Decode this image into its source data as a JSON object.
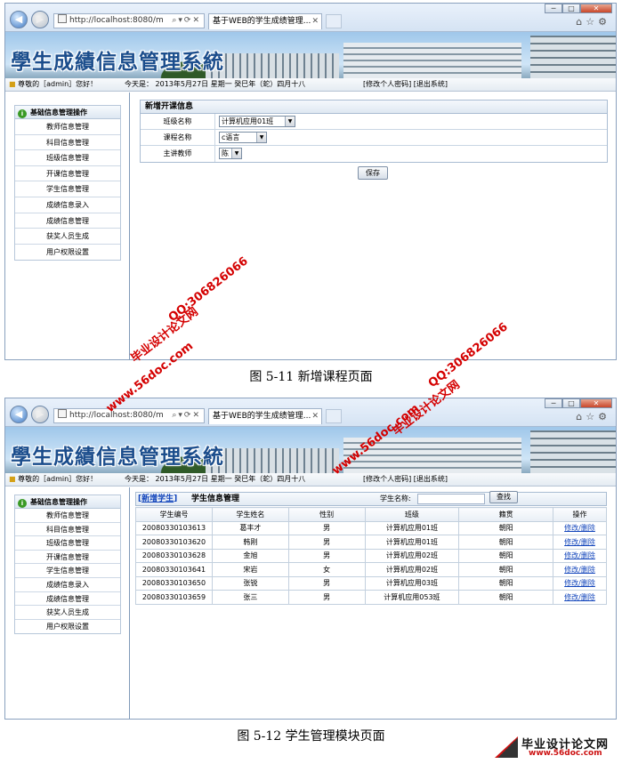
{
  "browser": {
    "address": "http://localhost:8080/m",
    "tab_title": "基于WEB的学生成绩管理...",
    "window_controls": [
      "─",
      "□",
      "✕"
    ]
  },
  "app": {
    "title": "學生成績信息管理系統",
    "greeting": "尊敬的［admin］您好！",
    "today": "今天是：  2013年5月27日  星期一  癸巳年（蛇）四月十八",
    "top_links": "[修改个人密码] [退出系统]"
  },
  "sidebar": {
    "heading": "基础信息管理操作",
    "items": [
      "教师信息管理",
      "科目信息管理",
      "班级信息管理",
      "开课信息管理",
      "学生信息管理",
      "成绩信息录入",
      "成绩信息管理",
      "获奖人员生成",
      "用户权限设置"
    ]
  },
  "course_form": {
    "heading": "新增开课信息",
    "fields": [
      {
        "label": "班级名称",
        "value": "计算机应用01班"
      },
      {
        "label": "课程名称",
        "value": "c语言"
      },
      {
        "label": "主讲教师",
        "value": "陈"
      }
    ],
    "save_label": "保存"
  },
  "student_list": {
    "add_link": "新增学生",
    "bracket_open": "[",
    "bracket_close": "]",
    "title": "学生信息管理",
    "search_label": "学生名称:",
    "search_value": "",
    "search_button": "查找",
    "columns": [
      "学生编号",
      "学生姓名",
      "性别",
      "班级",
      "籍贯",
      "操作"
    ],
    "rows": [
      [
        "20080330103613",
        "葛丰才",
        "男",
        "计算机应用01班",
        "朝阳",
        "修改/删除"
      ],
      [
        "20080330103620",
        "韩刚",
        "男",
        "计算机应用01班",
        "朝阳",
        "修改/删除"
      ],
      [
        "20080330103628",
        "金旭",
        "男",
        "计算机应用02班",
        "朝阳",
        "修改/删除"
      ],
      [
        "20080330103641",
        "宋岩",
        "女",
        "计算机应用02班",
        "朝阳",
        "修改/删除"
      ],
      [
        "20080330103650",
        "张锐",
        "男",
        "计算机应用03班",
        "朝阳",
        "修改/删除"
      ],
      [
        "20080330103659",
        "张三",
        "男",
        "计算机应用053班",
        "朝阳",
        "修改/删除"
      ]
    ]
  },
  "captions": {
    "fig1": "图 5-11  新增课程页面",
    "fig2": "图 5-12  学生管理模块页面"
  },
  "watermarks": {
    "qq": "QQ:306826066",
    "site": "www.56doc.com",
    "name": "毕业设计论文网"
  },
  "logo": {
    "name": "毕业设计论文网",
    "url": "www.56doc.com"
  },
  "colors": {
    "accent": "#1b4d8c",
    "link": "#1144bb",
    "watermark": "#d40000"
  }
}
